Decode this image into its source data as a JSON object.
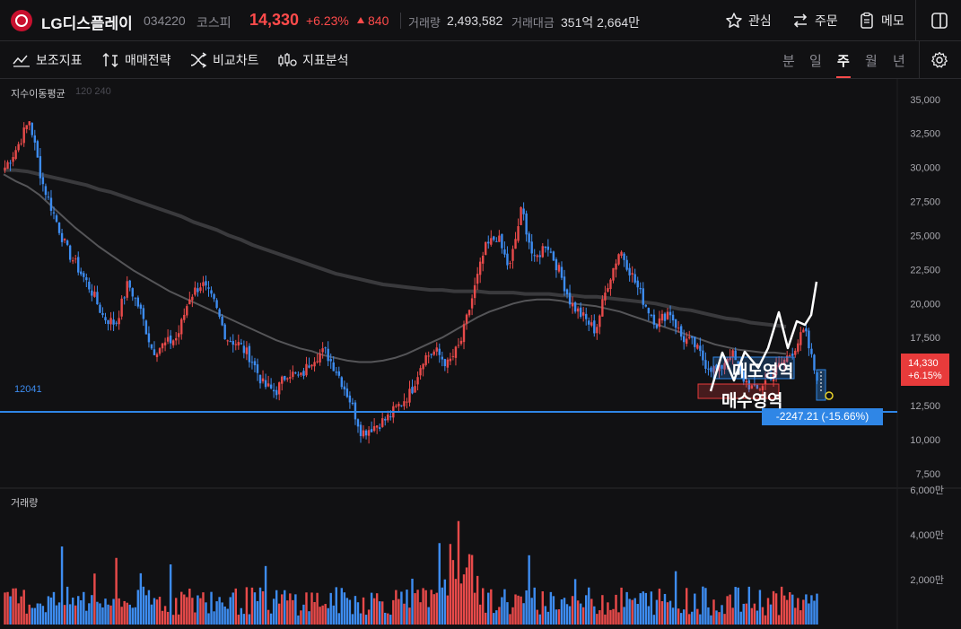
{
  "header": {
    "name": "LG디스플레이",
    "code": "034220",
    "market": "코스피",
    "price": "14,330",
    "change_pct": "+6.23%",
    "change_val": "840",
    "volume_label": "거래량",
    "volume": "2,493,582",
    "amount_label": "거래대금",
    "amount": "351억 2,664만",
    "watch_label": "관심",
    "order_label": "주문",
    "memo_label": "메모"
  },
  "toolbar": {
    "indicators_label": "보조지표",
    "strategy_label": "매매전략",
    "compare_label": "비교차트",
    "analysis_label": "지표분석",
    "periods": [
      "분",
      "일",
      "주",
      "월",
      "년"
    ],
    "active_period": "주"
  },
  "overlay": {
    "ma_label": "지수이동평균",
    "ma_params": "120 240",
    "volume_pane_label": "거래량",
    "hline_value_label": "12041",
    "price_tag_price": "14,330",
    "price_tag_pct": "+6.15%",
    "measure_label": "-2247.21 (-15.66%)",
    "sell_zone_label": "매도영역",
    "buy_zone_label": "매수영역"
  },
  "colors": {
    "up": "#e84a4a",
    "down": "#3d8cf0",
    "hline": "#2f86e6",
    "ma120": "#555558",
    "ma240": "#3a3a3d",
    "background": "#111113"
  },
  "chart_data": {
    "type": "line",
    "title": "",
    "price_axis": {
      "ticks": [
        "35,000",
        "32,500",
        "30,000",
        "27,500",
        "25,000",
        "22,500",
        "20,000",
        "17,500",
        "15,000",
        "12,500",
        "10,000",
        "7,500"
      ],
      "ylim": [
        6500,
        36500
      ]
    },
    "volume_axis": {
      "ticks": [
        "6,000만",
        "4,000만",
        "2,000만"
      ],
      "ylim": [
        0,
        6000
      ]
    },
    "series": [
      {
        "name": "",
        "kind": "weekly close (approx.)",
        "values": [
          30000,
          31500,
          33500,
          29000,
          26500,
          24000,
          22500,
          21000,
          19000,
          18500,
          21500,
          19500,
          16500,
          17000,
          17500,
          20500,
          21500,
          20000,
          17500,
          17000,
          16000,
          14000,
          13500,
          15000,
          14500,
          16000,
          16500,
          15000,
          13000,
          10500,
          11000,
          11500,
          12500,
          13500,
          16000,
          16500,
          15500,
          17000,
          20500,
          24000,
          25000,
          22500,
          27000,
          23000,
          24500,
          22500,
          20000,
          19000,
          18000,
          21500,
          24000,
          22000,
          20000,
          18500,
          19500,
          17500,
          17000,
          15500,
          15000,
          16500,
          14500,
          13500,
          14500,
          15500,
          16500,
          18000,
          14330
        ]
      },
      {
        "name": "120",
        "values": [
          29500,
          29000,
          28600,
          28000,
          27200,
          26400,
          25600,
          24900,
          24200,
          23600,
          23000,
          22400,
          21900,
          21400,
          20900,
          20500,
          20100,
          19700,
          19300,
          18900,
          18500,
          18100,
          17700,
          17300,
          17000,
          16700,
          16500,
          16200,
          16000,
          15800,
          15700,
          15700,
          15800,
          16000,
          16300,
          16700,
          17100,
          17500,
          18000,
          18500,
          19000,
          19400,
          19700,
          20000,
          20200,
          20300,
          20300,
          20200,
          20000,
          19900,
          19800,
          19600,
          19400,
          19100,
          18800,
          18500,
          18200,
          17900,
          17600,
          17300,
          17000,
          16800,
          16600,
          16500,
          16400,
          16400,
          16300
        ]
      },
      {
        "name": "240",
        "values": [
          29800,
          29800,
          29700,
          29500,
          29300,
          29100,
          28900,
          28700,
          28400,
          28200,
          27900,
          27600,
          27300,
          27000,
          26700,
          26400,
          26000,
          25700,
          25400,
          25000,
          24700,
          24300,
          24000,
          23700,
          23400,
          23100,
          22800,
          22500,
          22200,
          22000,
          21800,
          21600,
          21400,
          21300,
          21200,
          21100,
          21000,
          21000,
          20900,
          20900,
          20900,
          20800,
          20800,
          20800,
          20700,
          20700,
          20700,
          20600,
          20600,
          20500,
          20500,
          20400,
          20300,
          20200,
          20100,
          20000,
          19800,
          19600,
          19500,
          19300,
          19100,
          18900,
          18800,
          18600,
          18500,
          18400,
          18300
        ]
      },
      {
        "name": "12041",
        "kind": "horizontal line",
        "values": [
          12041
        ]
      }
    ],
    "grid": false,
    "legend": "none"
  }
}
